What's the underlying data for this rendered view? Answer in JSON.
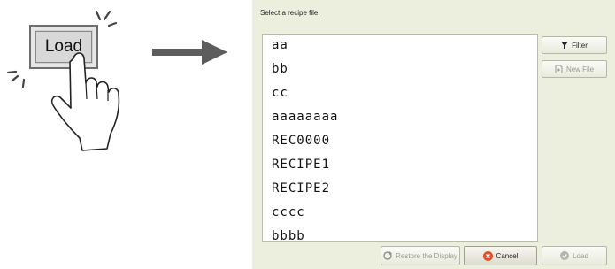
{
  "illustration": {
    "button_label": "Load"
  },
  "dialog": {
    "title": "Select a recipe file.",
    "files": [
      "aa",
      "bb",
      "cc",
      "aaaaaaaa",
      "REC0000",
      "RECIPE1",
      "RECIPE2",
      "cccc",
      "bbbb"
    ],
    "buttons": {
      "filter": "Filter",
      "new_file": "New File",
      "restore": "Restore the Display",
      "cancel": "Cancel",
      "load": "Load"
    }
  },
  "colors": {
    "dialog_bg": "#ecefde",
    "arrow": "#5d5d5d",
    "cancel_icon": "#e0502a",
    "disabled_text": "#9a9c90"
  }
}
